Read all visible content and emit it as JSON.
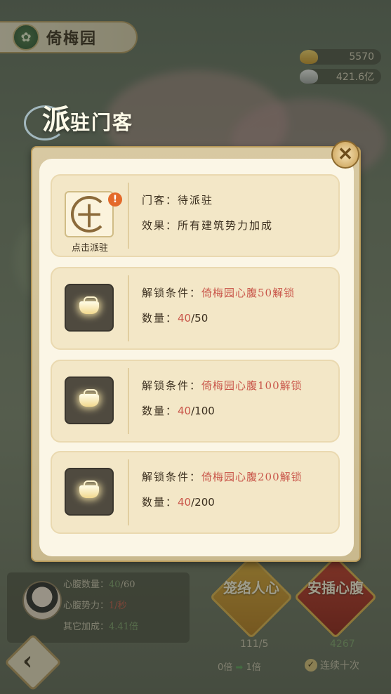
{
  "header": {
    "location_title": "倚梅园",
    "dialog_title_big": "派",
    "dialog_title_rest": "驻门客"
  },
  "currency": {
    "gold": "5570",
    "silver": "421.6亿"
  },
  "slots": [
    {
      "type": "recruit",
      "icon_caption": "点击派驻",
      "badge": "!",
      "line1_label": "门客：",
      "line1_value": "待派驻",
      "line2_label": "效果：",
      "line2_value": "所有建筑势力加成"
    },
    {
      "type": "locked",
      "line1_label": "解锁条件：",
      "line1_value": "倚梅园心腹50解锁",
      "line2_label": "数量：",
      "count_current": "40",
      "count_total": "/50"
    },
    {
      "type": "locked",
      "line1_label": "解锁条件：",
      "line1_value": "倚梅园心腹100解锁",
      "line2_label": "数量：",
      "count_current": "40",
      "count_total": "/100"
    },
    {
      "type": "locked",
      "line1_label": "解锁条件：",
      "line1_value": "倚梅园心腹200解锁",
      "line2_label": "数量：",
      "count_current": "40",
      "count_total": "/200"
    }
  ],
  "bottom_panel": {
    "stat1_label": "心腹数量：",
    "stat1_current": "40",
    "stat1_total": "/60",
    "stat2_label": "心腹势力：",
    "stat2_value": "1/秒",
    "stat3_label": "其它加成：",
    "stat3_value": "4.41倍"
  },
  "actions": {
    "left_button": "笼络人心",
    "left_cost": "111/5",
    "right_button": "安插心腹",
    "right_cost": "4267",
    "multiplier_from": "0倍",
    "multiplier_to": "1倍",
    "ten_times": "连续十次"
  },
  "close_symbol": "✕",
  "back_symbol": "‹",
  "colors": {
    "highlight_red": "#c9564a",
    "panel_cream": "#fbf6e6",
    "slot_bg": "#f3e7c7"
  }
}
